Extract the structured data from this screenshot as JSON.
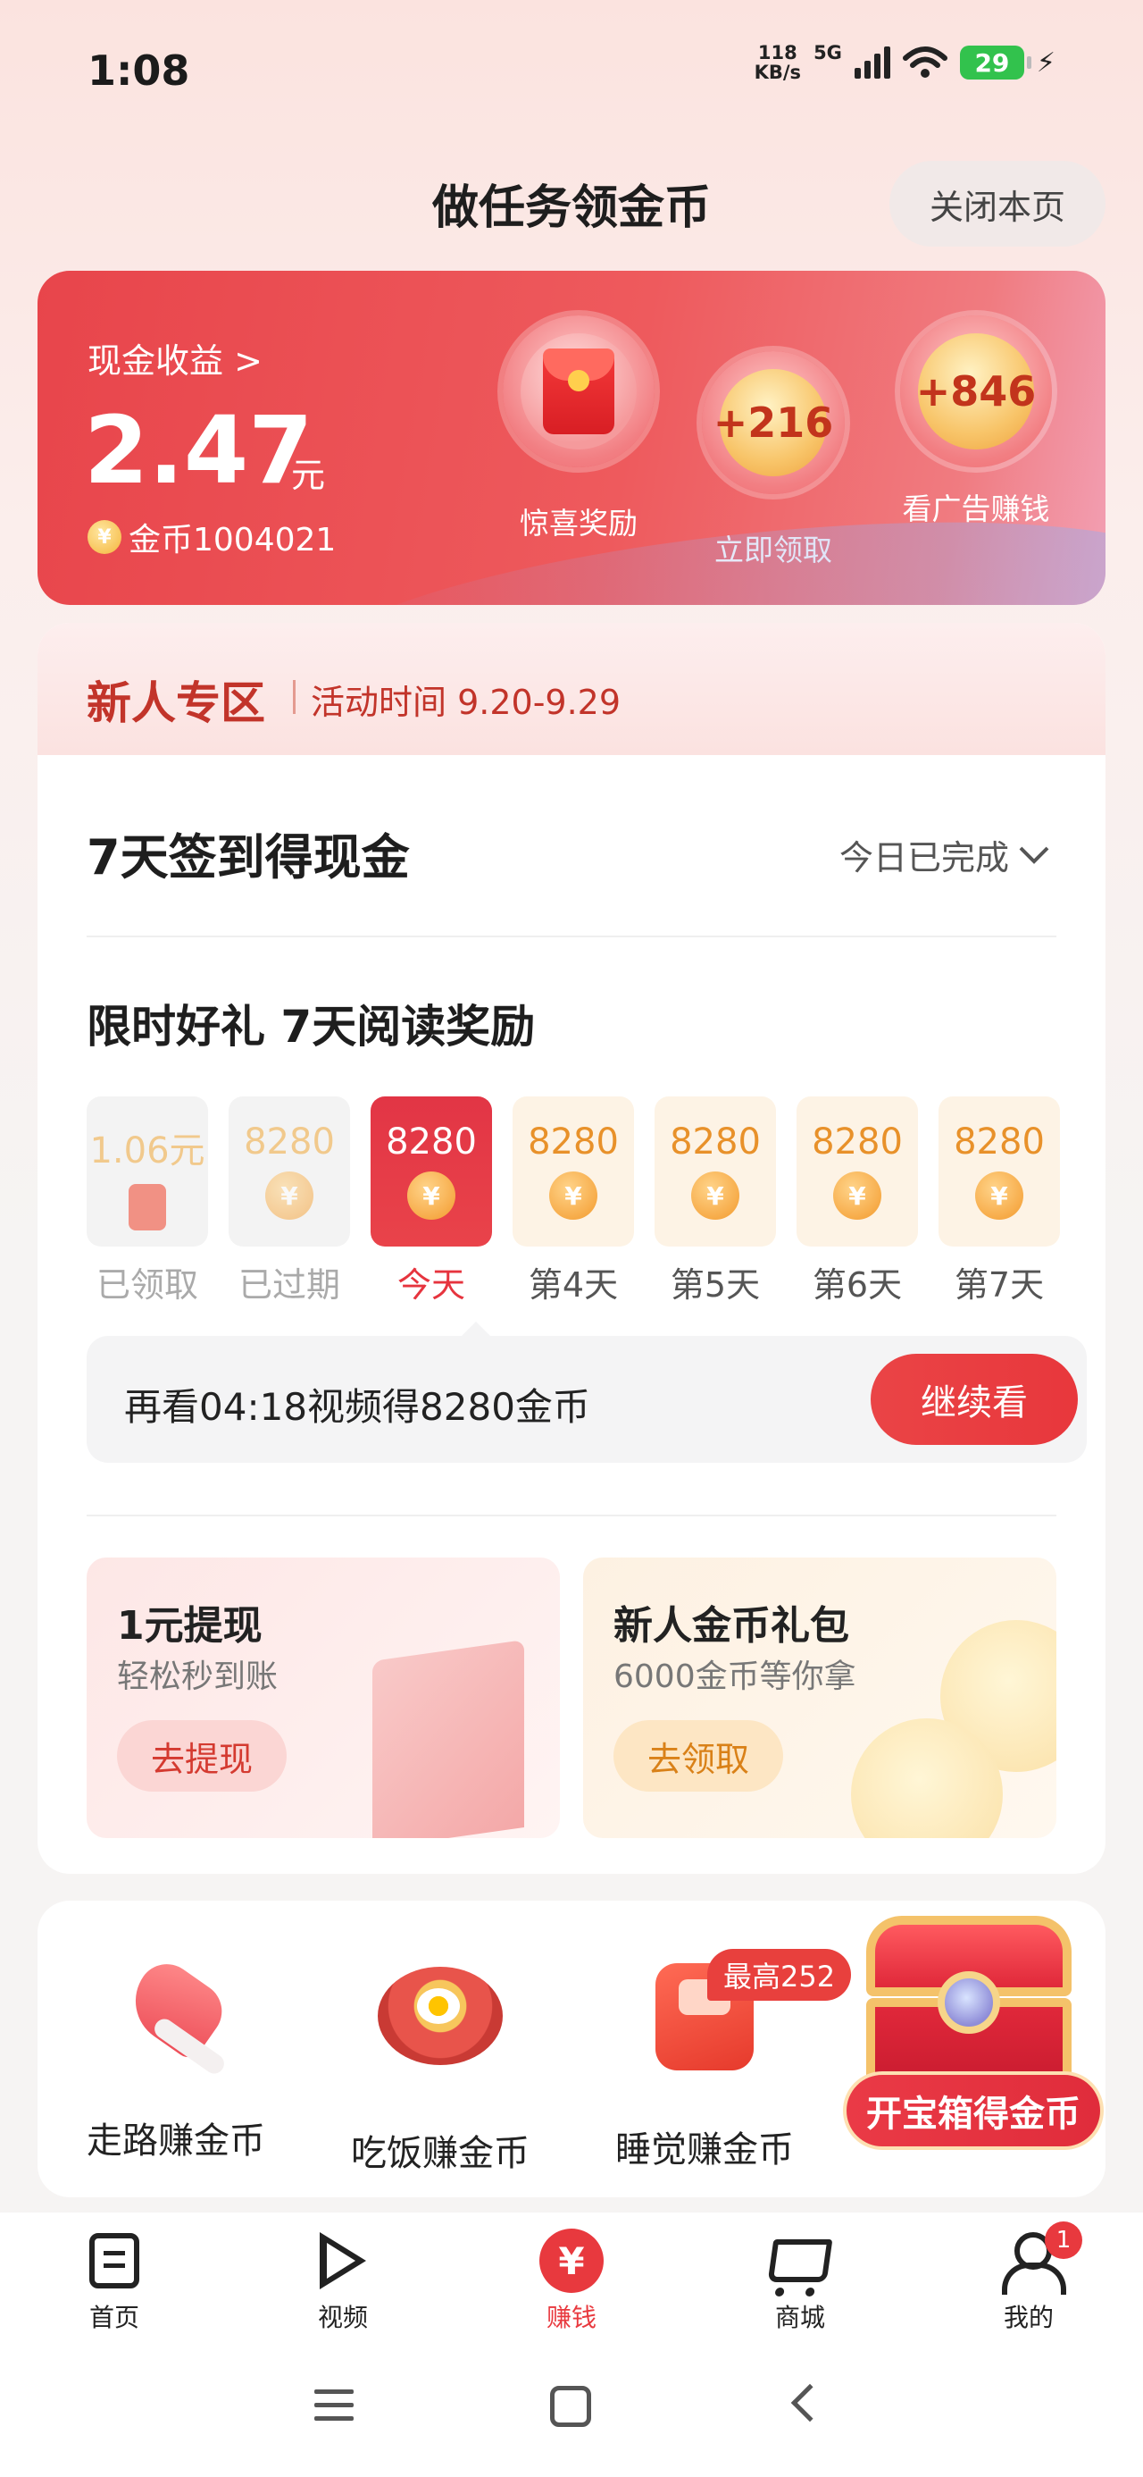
{
  "status_bar": {
    "time": "1:08",
    "net_speed_value": "118",
    "net_speed_unit": "KB/s",
    "network": "5G",
    "battery": "29"
  },
  "header": {
    "title": "做任务领金币",
    "close_label": "关闭本页"
  },
  "earnings": {
    "cash_label": "现金收益 >",
    "cash_amount": "2.47",
    "cash_unit": "元",
    "coin_icon": "¥",
    "coins": "金币1004021",
    "rewards": [
      {
        "value": "",
        "label": "惊喜奖励"
      },
      {
        "value": "+216",
        "label": "立即领取"
      },
      {
        "value": "+846",
        "label": "看广告赚钱"
      }
    ]
  },
  "newbie": {
    "title": "新人专区",
    "time": "活动时间 9.20-9.29"
  },
  "sign_in": {
    "title": "7天签到得现金",
    "status": "今日已完成"
  },
  "reading": {
    "title": "限时好礼 7天阅读奖励",
    "days": [
      {
        "value": "1.06元",
        "label": "已领取"
      },
      {
        "value": "8280",
        "label": "已过期"
      },
      {
        "value": "8280",
        "label": "今天"
      },
      {
        "value": "8280",
        "label": "第4天"
      },
      {
        "value": "8280",
        "label": "第5天"
      },
      {
        "value": "8280",
        "label": "第6天"
      },
      {
        "value": "8280",
        "label": "第7天"
      }
    ],
    "video_tip": "再看04:18视频得8280金币",
    "continue_label": "继续看"
  },
  "promos": [
    {
      "title": "1元提现",
      "subtitle": "轻松秒到账",
      "button": "去提现"
    },
    {
      "title": "新人金币礼包",
      "subtitle": "6000金币等你拿",
      "button": "去领取"
    }
  ],
  "tasks": [
    {
      "label": "走路赚金币"
    },
    {
      "label": "吃饭赚金币"
    },
    {
      "label": "睡觉赚金币",
      "badge": "最高252"
    }
  ],
  "chest_label": "开宝箱得金币",
  "bottom_nav": [
    {
      "label": "首页",
      "icon": "home-icon"
    },
    {
      "label": "视频",
      "icon": "play-icon"
    },
    {
      "label": "赚钱",
      "icon": "yen-icon"
    },
    {
      "label": "商城",
      "icon": "cart-icon"
    },
    {
      "label": "我的",
      "icon": "user-icon",
      "badge": "1"
    }
  ],
  "colors": {
    "accent": "#e8393e",
    "coin": "#e8912a"
  }
}
